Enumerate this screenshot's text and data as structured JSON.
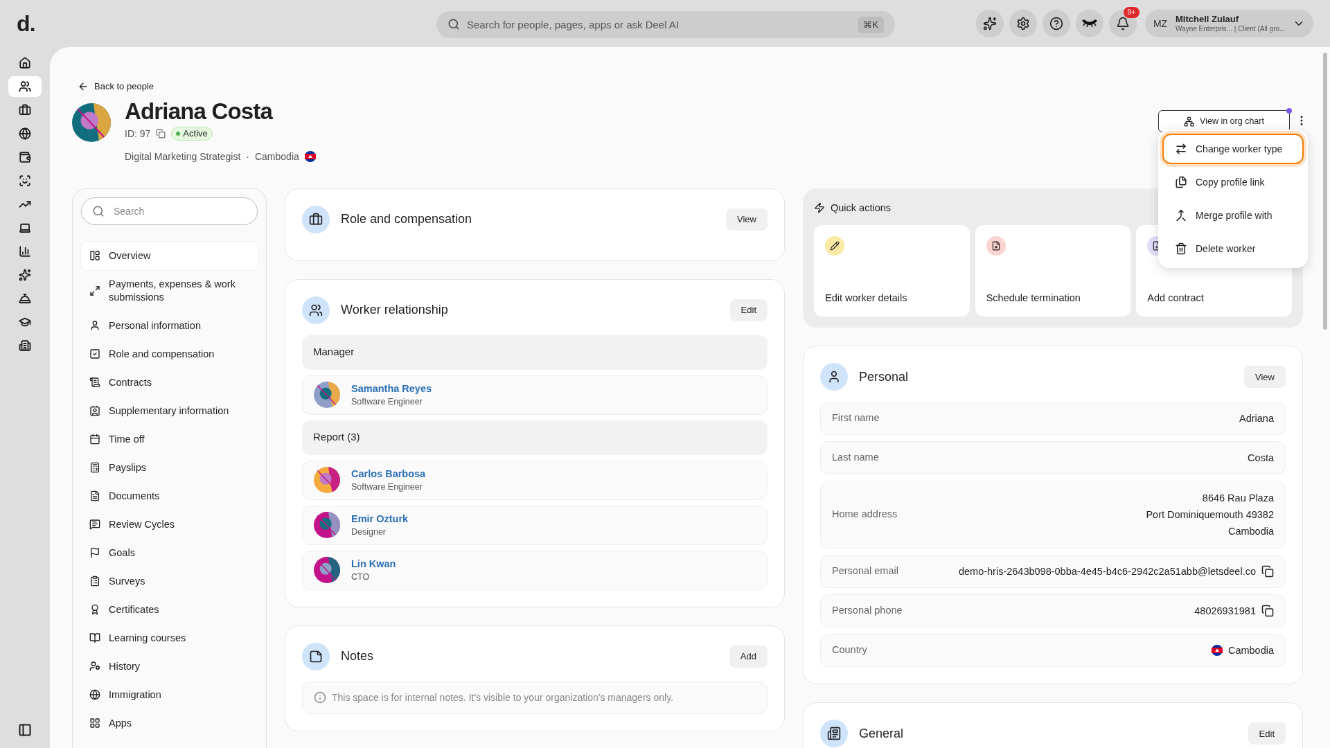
{
  "top_bar": {
    "logo": "d.",
    "search": {
      "placeholder": "Search for people, pages, apps or ask Deel AI",
      "shortcut": "⌘K"
    },
    "notifications_badge": "9+",
    "user": {
      "initials": "MZ",
      "name": "Mitchell Zulauf",
      "subtitle": "Wayne Enterpris... | Client (All gro..."
    }
  },
  "rail": {
    "items": [
      {
        "selected": false
      },
      {
        "selected": true
      },
      {
        "selected": false
      },
      {
        "selected": false
      },
      {
        "selected": false
      },
      {
        "selected": false
      },
      {
        "selected": false
      },
      {
        "selected": false
      },
      {
        "selected": false
      },
      {
        "selected": false
      },
      {
        "selected": false
      },
      {
        "selected": false
      },
      {
        "selected": false
      }
    ]
  },
  "back_link": "Back to people",
  "profile": {
    "name": "Adriana Costa",
    "id": "ID: 97",
    "status": "Active",
    "job_title": "Digital Marketing Strategist",
    "separator": "·",
    "country": "Cambodia"
  },
  "header_actions": {
    "org_chart_button": "View in org chart"
  },
  "more_menu": {
    "items": [
      {
        "label": "Change worker type",
        "focused": true
      },
      {
        "label": "Copy profile link",
        "focused": false
      },
      {
        "label": "Merge profile with",
        "focused": false
      },
      {
        "label": "Delete worker",
        "focused": false
      }
    ]
  },
  "nav": {
    "search_placeholder": "Search",
    "items": [
      {
        "label": "Overview",
        "selected": true
      },
      {
        "label": "Payments, expenses & work submissions",
        "selected": false
      },
      {
        "label": "Personal information",
        "selected": false
      },
      {
        "label": "Role and compensation",
        "selected": false
      },
      {
        "label": "Contracts",
        "selected": false
      },
      {
        "label": "Supplementary information",
        "selected": false
      },
      {
        "label": "Time off",
        "selected": false
      },
      {
        "label": "Payslips",
        "selected": false
      },
      {
        "label": "Documents",
        "selected": false
      },
      {
        "label": "Review Cycles",
        "selected": false
      },
      {
        "label": "Goals",
        "selected": false
      },
      {
        "label": "Surveys",
        "selected": false
      },
      {
        "label": "Certificates",
        "selected": false
      },
      {
        "label": "Learning courses",
        "selected": false
      },
      {
        "label": "History",
        "selected": false
      },
      {
        "label": "Immigration",
        "selected": false
      },
      {
        "label": "Apps",
        "selected": false
      }
    ]
  },
  "role_card": {
    "title": "Role and compensation",
    "button": "View"
  },
  "worker_relationship": {
    "title": "Worker relationship",
    "button": "Edit",
    "groups": [
      {
        "heading": "Manager",
        "people": [
          {
            "name": "Samantha Reyes",
            "role": "Software Engineer"
          }
        ]
      },
      {
        "heading": "Report (3)",
        "people": [
          {
            "name": "Carlos Barbosa",
            "role": "Software Engineer"
          },
          {
            "name": "Emir Ozturk",
            "role": "Designer"
          },
          {
            "name": "Lin Kwan",
            "role": "CTO"
          }
        ]
      }
    ]
  },
  "notes": {
    "title": "Notes",
    "button": "Add",
    "info": "This space is for internal notes. It's visible to your organization's managers only."
  },
  "quick_actions": {
    "title": "Quick actions",
    "items": [
      {
        "label": "Edit worker details",
        "color": "#fde9a6"
      },
      {
        "label": "Schedule termination",
        "color": "#fbd3d0"
      },
      {
        "label": "Add contract",
        "color": "#e3dcfb"
      }
    ]
  },
  "personal": {
    "title": "Personal",
    "button": "View",
    "fields": [
      {
        "label": "First name",
        "lines": [
          "Adriana"
        ],
        "copyable": false,
        "flag": false
      },
      {
        "label": "Last name",
        "lines": [
          "Costa"
        ],
        "copyable": false,
        "flag": false
      },
      {
        "label": "Home address",
        "lines": [
          "8646 Rau Plaza",
          "Port Dominiquemouth 49382",
          "Cambodia"
        ],
        "copyable": false,
        "flag": false
      },
      {
        "label": "Personal email",
        "lines": [
          "demo-hris-2643b098-0bba-4e45-b4c6-2942c2a51abb@letsdeel.co"
        ],
        "copyable": true,
        "flag": false
      },
      {
        "label": "Personal phone",
        "lines": [
          "48026931981"
        ],
        "copyable": true,
        "flag": false
      },
      {
        "label": "Country",
        "lines": [
          "Cambodia"
        ],
        "copyable": false,
        "flag": true
      }
    ]
  },
  "general": {
    "title": "General",
    "button": "Edit"
  }
}
